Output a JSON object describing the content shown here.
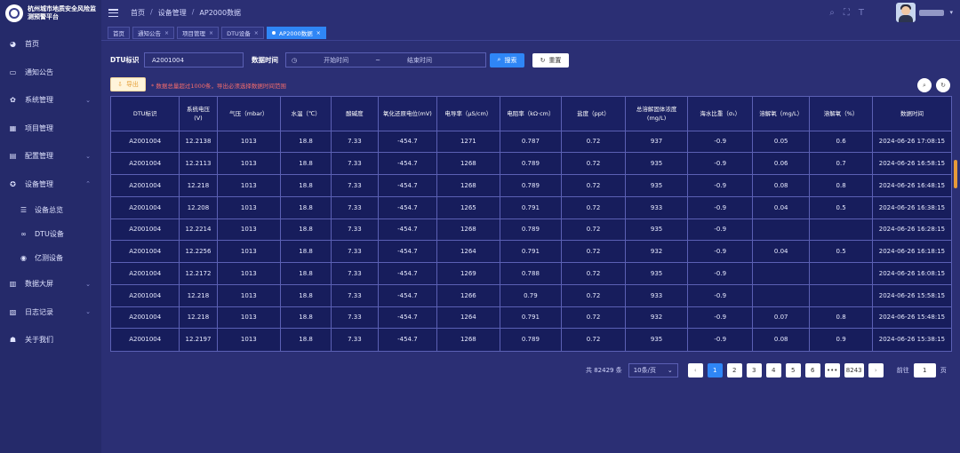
{
  "app": {
    "title": "杭州城市地质安全风险监测预警平台"
  },
  "sidebar": {
    "items": [
      {
        "label": "首页",
        "icon": "dashboard-icon"
      },
      {
        "label": "通知公告",
        "icon": "message-icon"
      },
      {
        "label": "系统管理",
        "icon": "gear-icon",
        "expandable": true
      },
      {
        "label": "项目管理",
        "icon": "project-icon"
      },
      {
        "label": "配置管理",
        "icon": "config-icon",
        "expandable": true
      },
      {
        "label": "设备管理",
        "icon": "device-icon",
        "expandable": true,
        "expanded": true
      },
      {
        "label": "设备总览",
        "icon": "list-icon",
        "sub": true
      },
      {
        "label": "DTU设备",
        "icon": "link-icon",
        "sub": true
      },
      {
        "label": "亿测设备",
        "icon": "radio-icon",
        "sub": true
      },
      {
        "label": "数据大屏",
        "icon": "screen-icon",
        "expandable": true
      },
      {
        "label": "日志记录",
        "icon": "log-icon",
        "expandable": true
      },
      {
        "label": "关于我们",
        "icon": "users-icon"
      }
    ]
  },
  "header": {
    "breadcrumb": [
      "首页",
      "设备管理",
      "AP2000数据"
    ],
    "icons": [
      "search-icon",
      "fullscreen-icon",
      "font-size-icon"
    ]
  },
  "tabs": [
    {
      "label": "首页",
      "closable": false,
      "active": false
    },
    {
      "label": "通知公告",
      "closable": true,
      "active": false
    },
    {
      "label": "项目管理",
      "closable": true,
      "active": false
    },
    {
      "label": "DTU设备",
      "closable": true,
      "active": false
    },
    {
      "label": "AP2000数据",
      "closable": true,
      "active": true
    }
  ],
  "filters": {
    "dtu_label": "DTU标识",
    "dtu_value": "A2001004",
    "time_label": "数据时间",
    "start_placeholder": "开始时间",
    "range_sep": "~",
    "end_placeholder": "结束时间",
    "search_label": "搜索",
    "reset_label": "重置",
    "export_label": "导出",
    "notice": "* 数据总量超过1000条，导出必须选择数据时间范围"
  },
  "table": {
    "columns": [
      "DTU标识",
      "系统电压(V)",
      "气压（mbar）",
      "水温（℃）",
      "酸碱度",
      "氧化还原电位(mV)",
      "电导率（μS/cm）",
      "电阻率（kΩ·cm）",
      "盐度（ppt）",
      "总溶解固体浓度(mg/L)",
      "海水比重（σ₁）",
      "溶解氧（mg/L）",
      "溶解氧（%）",
      "数据时间"
    ],
    "rows": [
      [
        "A2001004",
        "12.2138",
        "1013",
        "18.8",
        "7.33",
        "-454.7",
        "1271",
        "0.787",
        "0.72",
        "937",
        "-0.9",
        "0.05",
        "0.6",
        "2024-06-26 17:08:15"
      ],
      [
        "A2001004",
        "12.2113",
        "1013",
        "18.8",
        "7.33",
        "-454.7",
        "1268",
        "0.789",
        "0.72",
        "935",
        "-0.9",
        "0.06",
        "0.7",
        "2024-06-26 16:58:15"
      ],
      [
        "A2001004",
        "12.218",
        "1013",
        "18.8",
        "7.33",
        "-454.7",
        "1268",
        "0.789",
        "0.72",
        "935",
        "-0.9",
        "0.08",
        "0.8",
        "2024-06-26 16:48:15"
      ],
      [
        "A2001004",
        "12.208",
        "1013",
        "18.8",
        "7.33",
        "-454.7",
        "1265",
        "0.791",
        "0.72",
        "933",
        "-0.9",
        "0.04",
        "0.5",
        "2024-06-26 16:38:15"
      ],
      [
        "A2001004",
        "12.2214",
        "1013",
        "18.8",
        "7.33",
        "-454.7",
        "1268",
        "0.789",
        "0.72",
        "935",
        "-0.9",
        "",
        "",
        "2024-06-26 16:28:15"
      ],
      [
        "A2001004",
        "12.2256",
        "1013",
        "18.8",
        "7.33",
        "-454.7",
        "1264",
        "0.791",
        "0.72",
        "932",
        "-0.9",
        "0.04",
        "0.5",
        "2024-06-26 16:18:15"
      ],
      [
        "A2001004",
        "12.2172",
        "1013",
        "18.8",
        "7.33",
        "-454.7",
        "1269",
        "0.788",
        "0.72",
        "935",
        "-0.9",
        "",
        "",
        "2024-06-26 16:08:15"
      ],
      [
        "A2001004",
        "12.218",
        "1013",
        "18.8",
        "7.33",
        "-454.7",
        "1266",
        "0.79",
        "0.72",
        "933",
        "-0.9",
        "",
        "",
        "2024-06-26 15:58:15"
      ],
      [
        "A2001004",
        "12.218",
        "1013",
        "18.8",
        "7.33",
        "-454.7",
        "1264",
        "0.791",
        "0.72",
        "932",
        "-0.9",
        "0.07",
        "0.8",
        "2024-06-26 15:48:15"
      ],
      [
        "A2001004",
        "12.2197",
        "1013",
        "18.8",
        "7.33",
        "-454.7",
        "1268",
        "0.789",
        "0.72",
        "935",
        "-0.9",
        "0.08",
        "0.9",
        "2024-06-26 15:38:15"
      ]
    ]
  },
  "pagination": {
    "total_text": "共 82429 条",
    "page_size": "10条/页",
    "pages": [
      "1",
      "2",
      "3",
      "4",
      "5",
      "6",
      "•••",
      "8243"
    ],
    "current": "1",
    "goto_label": "前往",
    "goto_value": "1",
    "page_suffix": "页"
  },
  "colors": {
    "accent": "#2f86f6",
    "sidebar_bg": "#252a6a",
    "main_bg": "#2b2f74",
    "table_bg": "#171d5c",
    "warning": "#f56c6c"
  }
}
